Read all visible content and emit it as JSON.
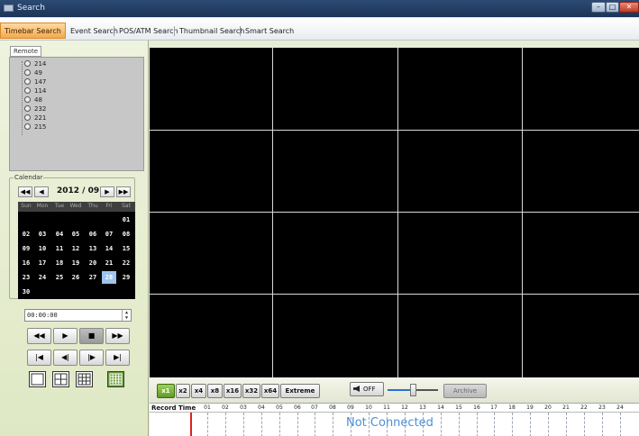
{
  "window": {
    "title": "Search",
    "controls": {
      "minimize": "–",
      "maximize": "□",
      "close": "✕"
    }
  },
  "tabs": [
    {
      "label": "Timebar Search",
      "active": true
    },
    {
      "label": "Event Search",
      "active": false
    },
    {
      "label": "POS/ATM Search",
      "active": false
    },
    {
      "label": "Thumbnail Search",
      "active": false
    },
    {
      "label": "Smart Search",
      "active": false
    }
  ],
  "remote": {
    "tab_label": "Remote",
    "cameras": [
      "214",
      "49",
      "147",
      "114",
      "48",
      "232",
      "221",
      "215"
    ]
  },
  "calendar": {
    "legend": "Calendar",
    "month_label": "2012 / 09",
    "nav": {
      "prev_year": "◀◀",
      "prev_month": "◀",
      "next_month": "▶",
      "next_year": "▶▶"
    },
    "weekdays": [
      "Sun",
      "Mon",
      "Tue",
      "Wed",
      "Thu",
      "Fri",
      "Sat"
    ],
    "weeks": [
      [
        "",
        "",
        "",
        "",
        "",
        "",
        "01"
      ],
      [
        "02",
        "03",
        "04",
        "05",
        "06",
        "07",
        "08"
      ],
      [
        "09",
        "10",
        "11",
        "12",
        "13",
        "14",
        "15"
      ],
      [
        "16",
        "17",
        "18",
        "19",
        "20",
        "21",
        "22"
      ],
      [
        "23",
        "24",
        "25",
        "26",
        "27",
        "28",
        "29"
      ],
      [
        "30",
        "",
        "",
        "",
        "",
        "",
        ""
      ]
    ],
    "selected_day": "28"
  },
  "time": {
    "value": "00:00:00",
    "spin_up": "▲",
    "spin_down": "▼"
  },
  "playback": {
    "row1": [
      "◀◀",
      "▶",
      "■",
      "▶▶"
    ],
    "row2": [
      "|◀",
      "◀|",
      "|▶",
      "▶|"
    ]
  },
  "speed": {
    "buttons": [
      "x1",
      "x2",
      "x4",
      "x8",
      "x16",
      "x32",
      "x64",
      "Extreme"
    ],
    "active": "x1",
    "mute_label": "OFF",
    "volume_level": 0.5,
    "archive_label": "Archive"
  },
  "timeline": {
    "label": "Record Time",
    "hours": [
      "01",
      "02",
      "03",
      "04",
      "05",
      "06",
      "07",
      "08",
      "09",
      "10",
      "11",
      "12",
      "13",
      "14",
      "15",
      "16",
      "17",
      "18",
      "19",
      "20",
      "21",
      "22",
      "23",
      "24"
    ],
    "status": "Not Connected"
  },
  "colors": {
    "accent": "#f5a94e",
    "selected_day": "#9ec3ee",
    "status_text": "#4b8fd6",
    "playhead": "#e02020"
  }
}
